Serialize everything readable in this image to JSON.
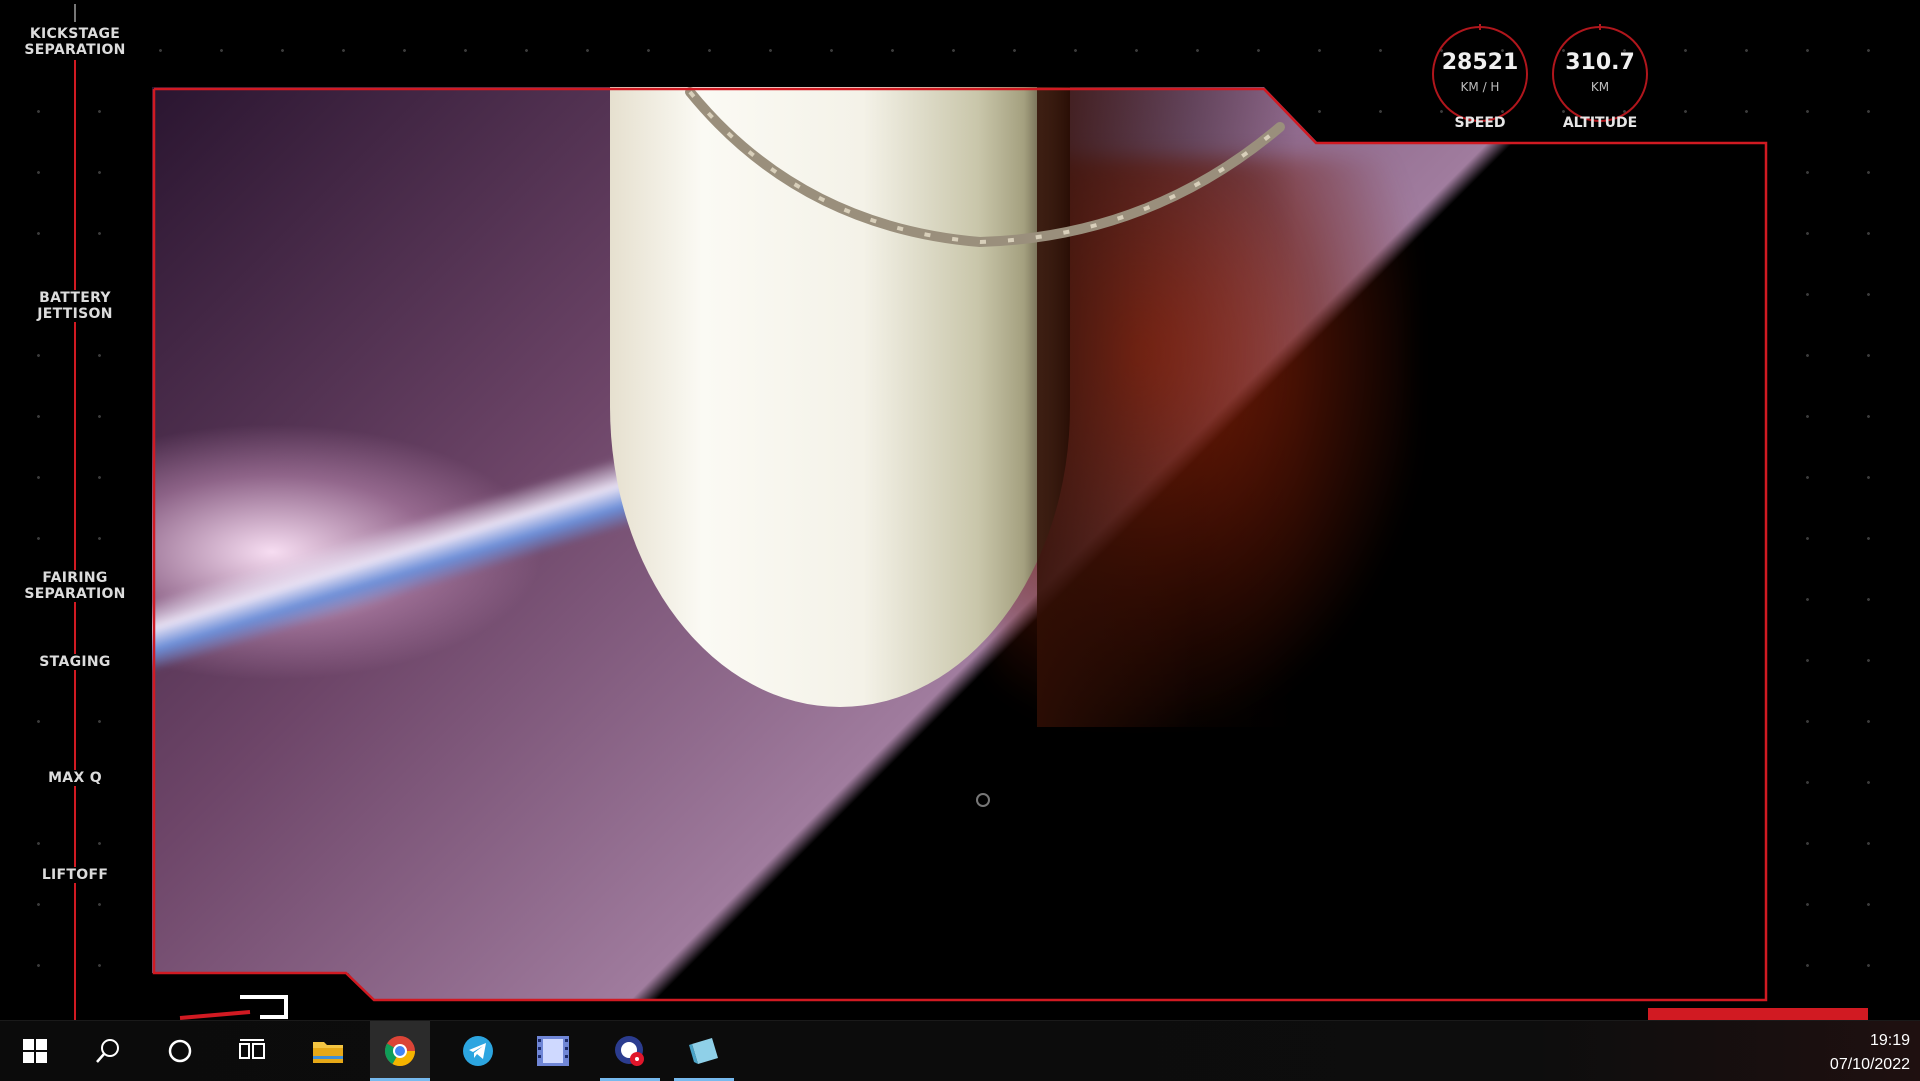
{
  "timeline": {
    "events": [
      {
        "line1": "KICKSTAGE",
        "line2": "SEPARATION"
      },
      {
        "line1": "BATTERY",
        "line2": "JETTISON"
      },
      {
        "line1": "FAIRING",
        "line2": "SEPARATION"
      },
      {
        "line1": "STAGING",
        "line2": ""
      },
      {
        "line1": "MAX Q",
        "line2": ""
      },
      {
        "line1": "LIFTOFF",
        "line2": ""
      }
    ]
  },
  "telemetry": {
    "speed": {
      "value": "28521",
      "unit": "KM / H",
      "label": "SPEED"
    },
    "altitude": {
      "value": "310.7",
      "unit": "KM",
      "label": "ALTITUDE"
    }
  },
  "colors": {
    "accent": "#d11a22",
    "taskbar": "#0b0b0b",
    "highlight": "#76b9ed"
  },
  "taskbar": {
    "icons": [
      "windows-start-icon",
      "search-icon",
      "cortana-icon",
      "task-view-icon",
      "file-explorer-icon",
      "chrome-icon",
      "telegram-icon",
      "video-player-icon",
      "recorder-icon",
      "notes-icon"
    ],
    "time": "19:19",
    "date": "07/10/2022"
  }
}
